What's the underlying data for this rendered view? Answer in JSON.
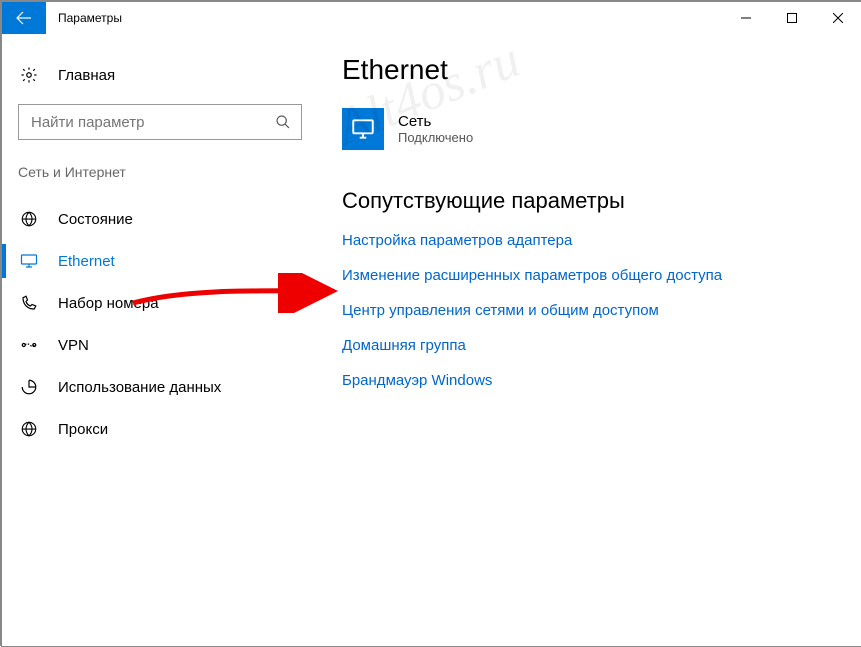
{
  "window": {
    "title": "Параметры"
  },
  "sidebar": {
    "home_label": "Главная",
    "search_placeholder": "Найти параметр",
    "category_label": "Сеть и Интернет",
    "items": [
      {
        "id": "status",
        "label": "Состояние",
        "selected": false
      },
      {
        "id": "ethernet",
        "label": "Ethernet",
        "selected": true
      },
      {
        "id": "dialup",
        "label": "Набор номера",
        "selected": false
      },
      {
        "id": "vpn",
        "label": "VPN",
        "selected": false
      },
      {
        "id": "datausage",
        "label": "Использование данных",
        "selected": false
      },
      {
        "id": "proxy",
        "label": "Прокси",
        "selected": false
      }
    ]
  },
  "main": {
    "page_title": "Ethernet",
    "network": {
      "name": "Сеть",
      "status": "Подключено"
    },
    "related_heading": "Сопутствующие параметры",
    "links": [
      "Настройка параметров адаптера",
      "Изменение расширенных параметров общего доступа",
      "Центр управления сетями и общим доступом",
      "Домашняя группа",
      "Брандмауэр Windows"
    ]
  },
  "watermark": "Alt4os.ru"
}
